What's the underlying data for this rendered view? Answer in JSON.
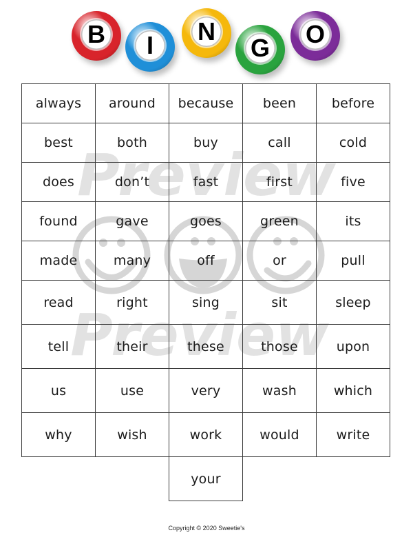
{
  "header": {
    "balls": [
      {
        "letter": "B",
        "color": "#d8242b"
      },
      {
        "letter": "I",
        "color": "#1f8fd8"
      },
      {
        "letter": "N",
        "color": "#f5b80c"
      },
      {
        "letter": "G",
        "color": "#2aa33e"
      },
      {
        "letter": "O",
        "color": "#7c2c99"
      }
    ]
  },
  "watermark": {
    "text": "Preview",
    "icon": "smiley-face-icon",
    "color": "#d9d9d9"
  },
  "words": [
    [
      "always",
      "around",
      "because",
      "been",
      "before"
    ],
    [
      "best",
      "both",
      "buy",
      "call",
      "cold"
    ],
    [
      "does",
      "don’t",
      "fast",
      "first",
      "five"
    ],
    [
      "found",
      "gave",
      "goes",
      "green",
      "its"
    ],
    [
      "made",
      "many",
      "off",
      "or",
      "pull"
    ],
    [
      "read",
      "right",
      "sing",
      "sit",
      "sleep"
    ],
    [
      "tell",
      "their",
      "these",
      "those",
      "upon"
    ],
    [
      "us",
      "use",
      "very",
      "wash",
      "which"
    ],
    [
      "why",
      "wish",
      "work",
      "would",
      "write"
    ]
  ],
  "extra_word": "your",
  "footer": {
    "copyright": "Copyright © 2020 Sweetie's"
  }
}
